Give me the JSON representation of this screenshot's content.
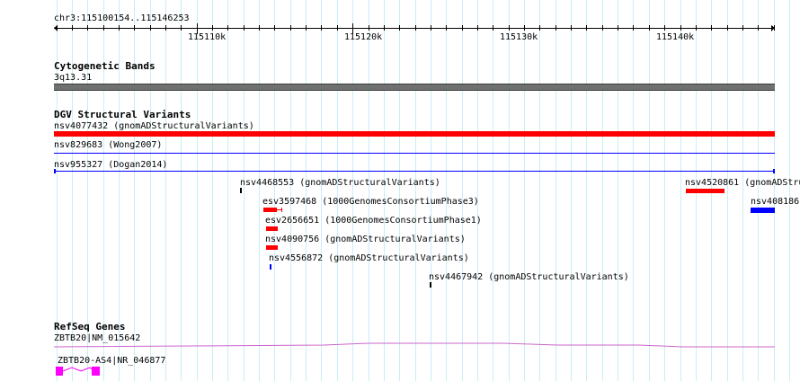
{
  "location": "chr3:115100154..115146253",
  "ruler": {
    "labels": [
      "115110k",
      "115120k",
      "115130k",
      "115140k"
    ]
  },
  "tracks": {
    "cytoband": {
      "title": "Cytogenetic Bands",
      "band": "3q13.31"
    },
    "dgv": {
      "title": "DGV Structural Variants",
      "features": [
        {
          "label": "nsv4077432 (gnomADStructuralVariants)"
        },
        {
          "label": "nsv829683 (Wong2007)"
        },
        {
          "label": "nsv955327 (Dogan2014)"
        },
        {
          "label": "nsv4468553 (gnomADStructuralVariants)"
        },
        {
          "label": "nsv4520861 (gnomADStru"
        },
        {
          "label": "esv3597468 (1000GenomesConsortiumPhase3)"
        },
        {
          "label": "nsv408186"
        },
        {
          "label": "esv2656651 (1000GenomesConsortiumPhase1)"
        },
        {
          "label": "nsv4090756 (gnomADStructuralVariants)"
        },
        {
          "label": "nsv4556872 (gnomADStructuralVariants)"
        },
        {
          "label": "nsv4467942 (gnomADStructuralVariants)"
        }
      ]
    },
    "refseq": {
      "title": "RefSeq Genes",
      "genes": [
        {
          "label": "ZBTB20|NM_015642"
        },
        {
          "label": "ZBTB20-AS4|NR_046877"
        }
      ]
    }
  },
  "colors": {
    "gridline": "#c8eef7",
    "cytoband": "#707070",
    "gain": "#ff0000",
    "loss": "#0000ff",
    "gene": "#ff00ff",
    "gene_line": "#cc66cc"
  }
}
